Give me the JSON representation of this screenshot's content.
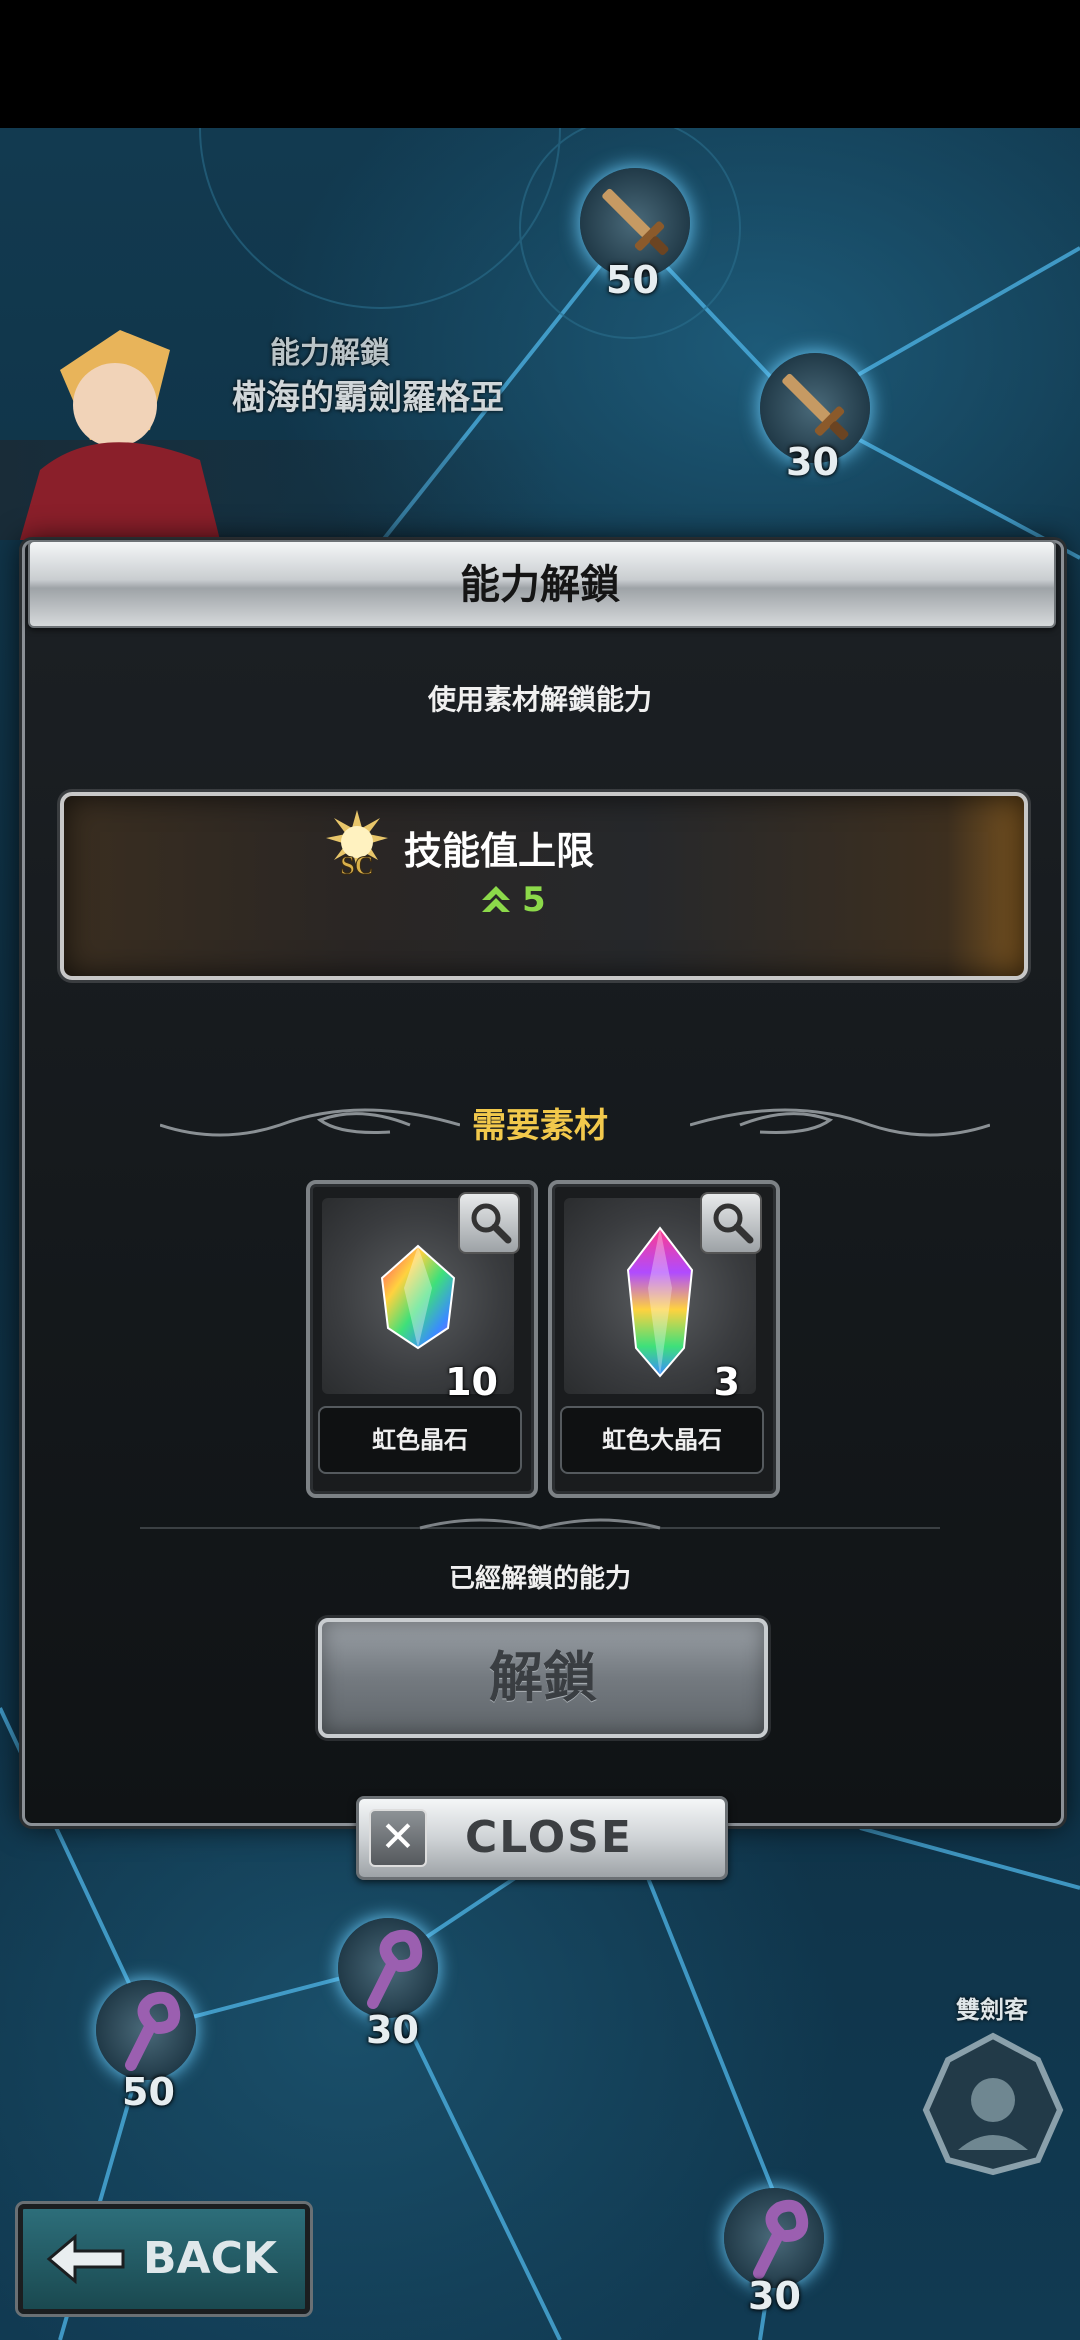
{
  "dialog": {
    "title": "能力解鎖",
    "subtitle": "使用素材解鎖能力",
    "skill": {
      "name": "技能值上限",
      "icon_badge": "SC",
      "value": "5"
    },
    "materials_title": "需要素材",
    "materials": [
      {
        "name": "虹色晶石",
        "count": "10"
      },
      {
        "name": "虹色大晶石",
        "count": "3"
      }
    ],
    "unlocked_text": "已經解鎖的能力",
    "unlock_label": "解鎖",
    "close_label": "CLOSE"
  },
  "character": {
    "subtitle": "能力解鎖",
    "name": "樹海的霸劍羅格亞"
  },
  "map_nodes": [
    {
      "label": "50"
    },
    {
      "label": "30"
    },
    {
      "label": "30"
    },
    {
      "label": "50"
    },
    {
      "label": "30"
    }
  ],
  "class_label": "雙劍客",
  "back_label": "BACK",
  "colors": {
    "accent_gold": "#f2c94c",
    "value_green": "#8cd94a",
    "scene_blue": "#123a50"
  }
}
